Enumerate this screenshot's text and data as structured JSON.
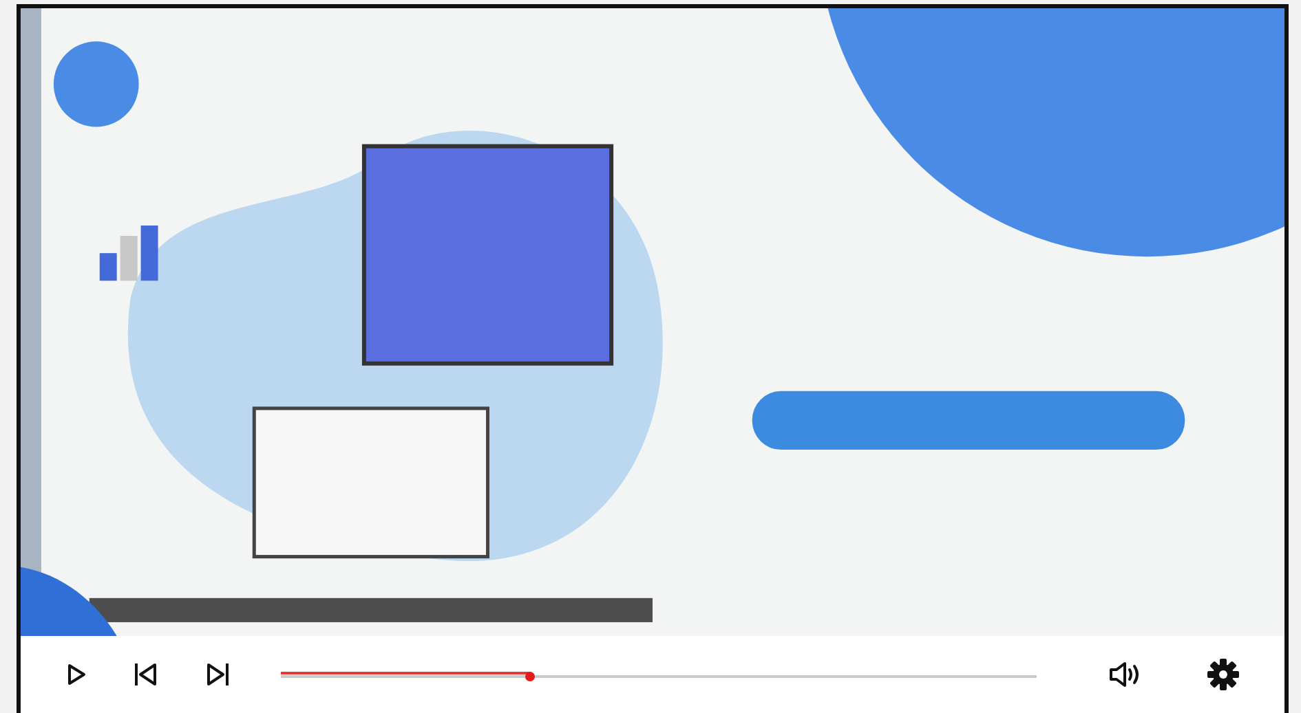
{
  "player": {
    "progress": {
      "level": 0.33
    }
  }
}
